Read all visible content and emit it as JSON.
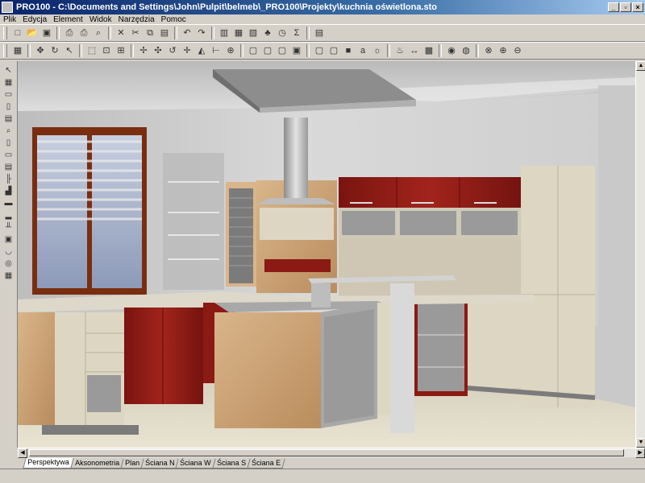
{
  "window": {
    "title": "PRO100 - C:\\Documents and Settings\\John\\Pulpit\\belmeb\\_PRO100\\Projekty\\kuchnia oświetlona.sto",
    "buttons": {
      "minimize": "_",
      "maximize": "▫",
      "close": "×"
    }
  },
  "menu": [
    "Plik",
    "Edycja",
    "Element",
    "Widok",
    "Narzędzia",
    "Pomoc"
  ],
  "toolbar1": [
    {
      "name": "new-icon",
      "glyph": "□"
    },
    {
      "name": "open-icon",
      "glyph": "📂"
    },
    {
      "name": "save-icon",
      "glyph": "▣"
    },
    {
      "sep": true
    },
    {
      "name": "print-preview-icon",
      "glyph": "⎙"
    },
    {
      "name": "print-icon",
      "glyph": "⎙"
    },
    {
      "name": "find-icon",
      "glyph": "⌕"
    },
    {
      "sep": true
    },
    {
      "name": "delete-icon",
      "glyph": "✕"
    },
    {
      "name": "cut-icon",
      "glyph": "✂"
    },
    {
      "name": "copy-icon",
      "glyph": "⧉"
    },
    {
      "name": "paste-icon",
      "glyph": "▤"
    },
    {
      "sep": true
    },
    {
      "name": "undo-icon",
      "glyph": "↶"
    },
    {
      "name": "redo-icon",
      "glyph": "↷"
    },
    {
      "sep": true
    },
    {
      "name": "properties-icon",
      "glyph": "▥"
    },
    {
      "name": "library-icon",
      "glyph": "▦"
    },
    {
      "name": "materials-icon",
      "glyph": "▧"
    },
    {
      "name": "tree-icon",
      "glyph": "♣"
    },
    {
      "name": "clock-icon",
      "glyph": "◷"
    },
    {
      "name": "sum-icon",
      "glyph": "Σ"
    },
    {
      "sep": true
    },
    {
      "name": "report-icon",
      "glyph": "▤"
    }
  ],
  "toolbar2": [
    {
      "name": "grid-icon",
      "glyph": "▦"
    },
    {
      "sep": true
    },
    {
      "name": "move-icon",
      "glyph": "✥"
    },
    {
      "name": "rotate-view-icon",
      "glyph": "↻"
    },
    {
      "name": "select-icon",
      "glyph": "↖"
    },
    {
      "sep": true
    },
    {
      "name": "frame-icon",
      "glyph": "⬚"
    },
    {
      "name": "fit-icon",
      "glyph": "⊡"
    },
    {
      "name": "lock-icon",
      "glyph": "⊞"
    },
    {
      "sep": true
    },
    {
      "name": "pan-icon",
      "glyph": "✢"
    },
    {
      "name": "orbit-icon",
      "glyph": "✣"
    },
    {
      "name": "spin-icon",
      "glyph": "↺"
    },
    {
      "name": "cross-move-icon",
      "glyph": "✛"
    },
    {
      "name": "mirror-icon",
      "glyph": "◭"
    },
    {
      "name": "measure-icon",
      "glyph": "⊢"
    },
    {
      "name": "target-icon",
      "glyph": "⊕"
    },
    {
      "sep": true
    },
    {
      "name": "box-view1-icon",
      "glyph": "▢"
    },
    {
      "name": "box-view2-icon",
      "glyph": "▢"
    },
    {
      "name": "box-view3-icon",
      "glyph": "▢"
    },
    {
      "name": "box-view4-icon",
      "glyph": "▣"
    },
    {
      "sep": true
    },
    {
      "name": "box-wire-icon",
      "glyph": "▢"
    },
    {
      "name": "box-hidden-icon",
      "glyph": "▢"
    },
    {
      "name": "box-solid-icon",
      "glyph": "■"
    },
    {
      "name": "text-icon",
      "glyph": "a"
    },
    {
      "name": "light-icon",
      "glyph": "☼"
    },
    {
      "sep": true
    },
    {
      "name": "lamp-icon",
      "glyph": "♨"
    },
    {
      "name": "dimension-icon",
      "glyph": "↔"
    },
    {
      "name": "hatch-icon",
      "glyph": "▩"
    },
    {
      "sep": true
    },
    {
      "name": "render-icon",
      "glyph": "◉"
    },
    {
      "name": "color-wheel-icon",
      "glyph": "◍"
    },
    {
      "sep": true
    },
    {
      "name": "stop-icon",
      "glyph": "⊗"
    },
    {
      "name": "zoom-in-icon",
      "glyph": "⊕"
    },
    {
      "name": "zoom-out-icon",
      "glyph": "⊖"
    }
  ],
  "lefttools": [
    {
      "name": "pointer-icon",
      "glyph": "↖"
    },
    {
      "name": "grid-tool-icon",
      "glyph": "▦"
    },
    {
      "name": "cabinet-icon",
      "glyph": "▭"
    },
    {
      "name": "door-icon",
      "glyph": "▯"
    },
    {
      "name": "wall-cabinet-icon",
      "glyph": "▤"
    },
    {
      "name": "zoom-tool-icon",
      "glyph": "⌕"
    },
    {
      "name": "panel-icon",
      "glyph": "▯"
    },
    {
      "name": "shelf-icon",
      "glyph": "▭"
    },
    {
      "name": "drawer-icon",
      "glyph": "▤"
    },
    {
      "name": "handle-icon",
      "glyph": "╟"
    },
    {
      "name": "corner-icon",
      "glyph": "▟"
    },
    {
      "name": "worktop-icon",
      "glyph": "▬"
    },
    {
      "name": "plinth-icon",
      "glyph": "▂"
    },
    {
      "name": "legs-icon",
      "glyph": "╨"
    },
    {
      "name": "back-panel-icon",
      "glyph": "▣"
    },
    {
      "name": "sink-icon",
      "glyph": "◡"
    },
    {
      "name": "hob-icon",
      "glyph": "◎"
    },
    {
      "name": "appliance-icon",
      "glyph": "▦"
    }
  ],
  "tabs": [
    "Perspektywa",
    "Aksonometria",
    "Plan",
    "Ściana N",
    "Ściana W",
    "Ściana S",
    "Ściana E"
  ],
  "active_tab": "Perspektywa",
  "colors": {
    "titlebar": "#0a246a",
    "face": "#d4d0c8",
    "cabinet_red": "#8b1a14",
    "cabinet_cream": "#ddd6c2",
    "wood": "#c9a171"
  }
}
